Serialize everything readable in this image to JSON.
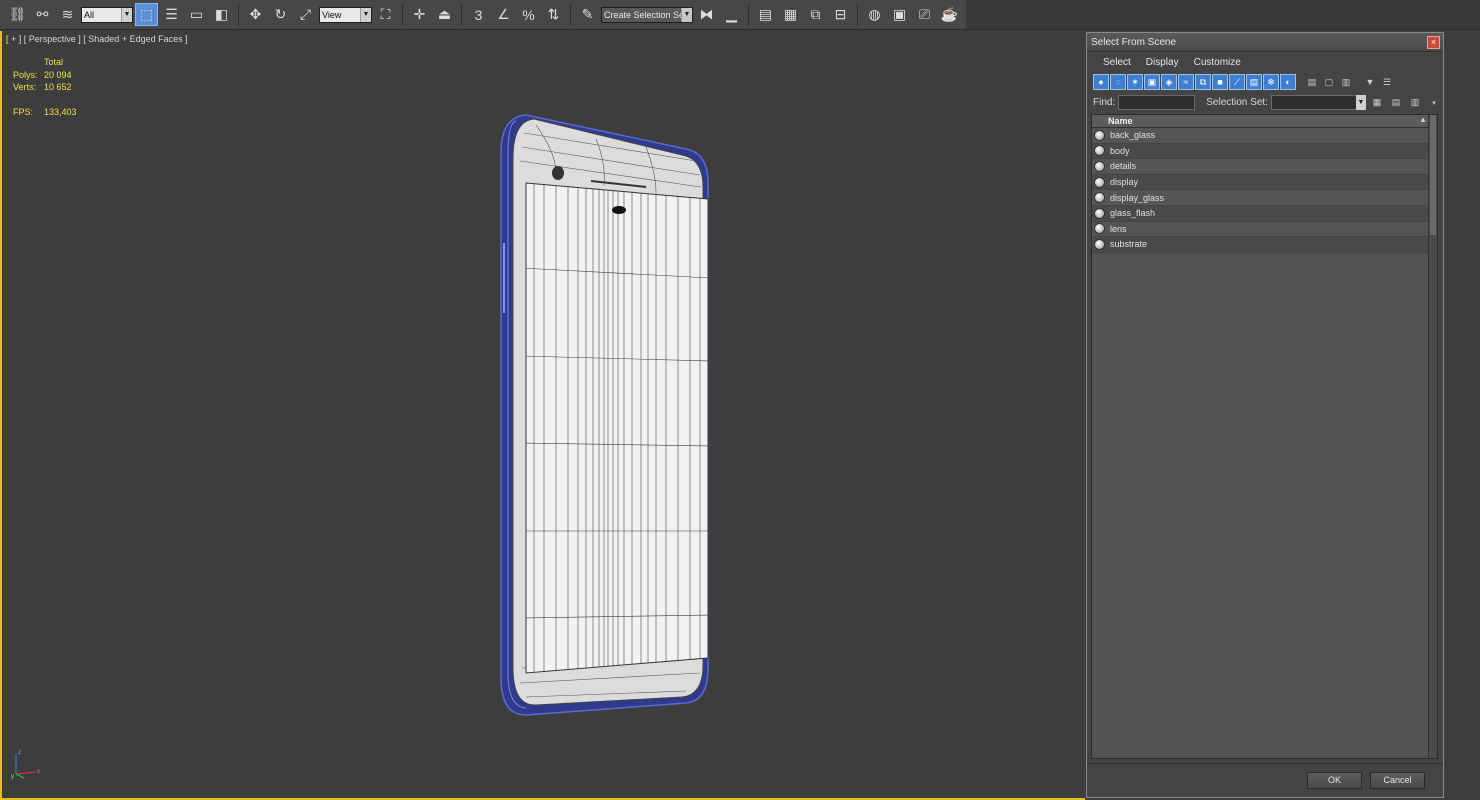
{
  "toolbar": {
    "selection_filter": "All",
    "reference_coord": "View",
    "named_selection": "Create Selection Se"
  },
  "viewport": {
    "label": "[ + ] [ Perspective ] [ Shaded + Edged Faces ]",
    "stats": {
      "total_label": "Total",
      "polys_label": "Polys:",
      "polys_value": "20 094",
      "verts_label": "Verts:",
      "verts_value": "10 652",
      "fps_label": "FPS:",
      "fps_value": "133,403"
    },
    "axis": {
      "x": "x",
      "y": "y",
      "z": "z"
    },
    "colors": {
      "stats": "#e7e34a",
      "active_border": "#e0c020",
      "wire_blue": "#3b47a8"
    }
  },
  "dialog": {
    "title": "Select From Scene",
    "close_glyph": "×",
    "menu": [
      "Select",
      "Display",
      "Customize"
    ],
    "find_label": "Find:",
    "selection_set_label": "Selection Set:",
    "list_header": "Name",
    "objects": [
      "back_glass",
      "body",
      "details",
      "display",
      "display_glass",
      "glass_flash",
      "lens",
      "substrate"
    ],
    "ok_label": "OK",
    "cancel_label": "Cancel"
  }
}
